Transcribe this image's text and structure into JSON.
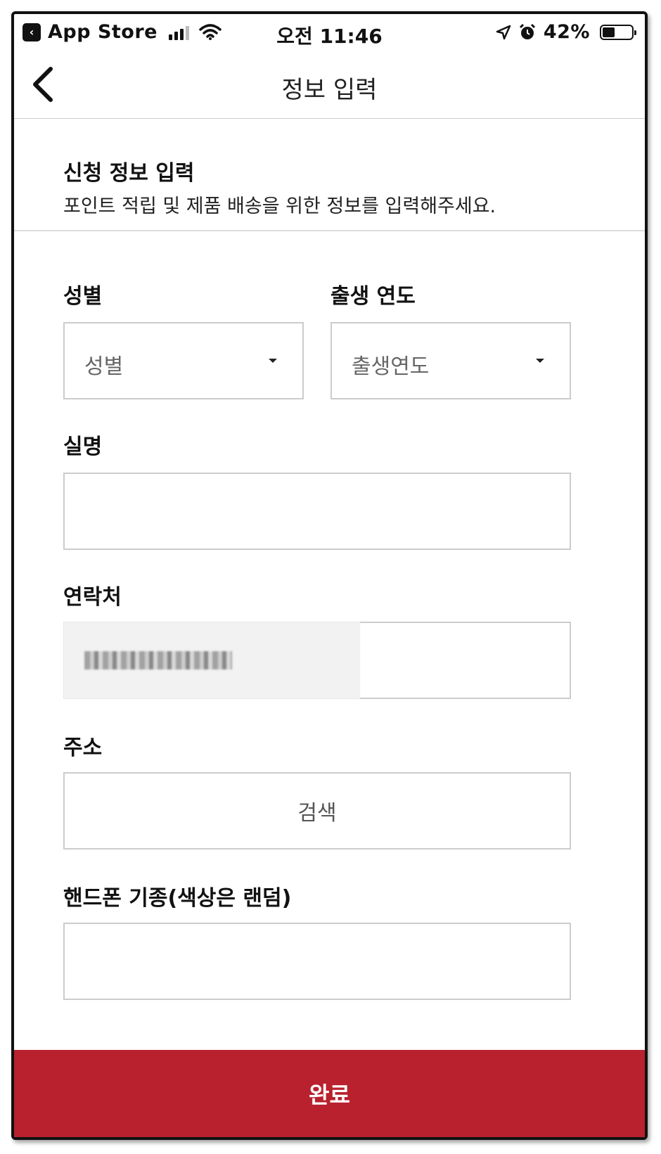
{
  "status_bar": {
    "back_app_label": "App Store",
    "time": "오전 11:46",
    "battery": "42%",
    "battery_level": 0.42
  },
  "nav": {
    "title": "정보 입력"
  },
  "intro": {
    "title": "신청 정보 입력",
    "description": "포인트 적립 및 제품 배송을 위한 정보를 입력해주세요."
  },
  "form": {
    "gender": {
      "label": "성별",
      "selected": "성별"
    },
    "birth_year": {
      "label": "출생 연도",
      "selected": "출생연도"
    },
    "name": {
      "label": "실명",
      "value": ""
    },
    "phone": {
      "label": "연락처"
    },
    "address": {
      "label": "주소",
      "search_label": "검색"
    },
    "device": {
      "label": "핸드폰 기종(색상은 랜덤)",
      "value": ""
    }
  },
  "submit": {
    "label": "완료"
  },
  "colors": {
    "accent": "#b8212d"
  }
}
